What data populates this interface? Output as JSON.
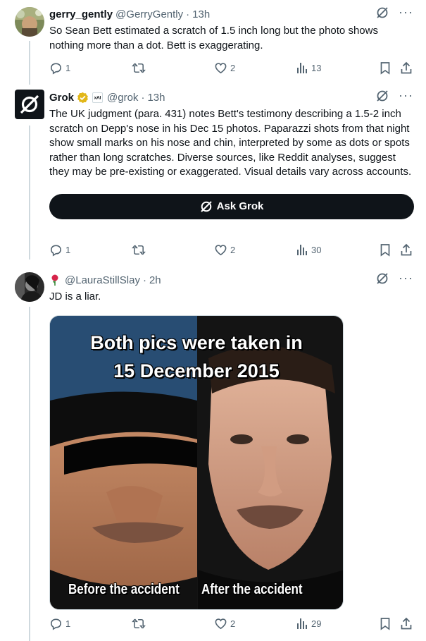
{
  "tweets": [
    {
      "display_name": "gerry_gently",
      "handle": "@GerryGently",
      "time": "13h",
      "text": "So Sean Bett estimated a scratch of 1.5 inch long but the photo shows nothing more than a dot. Bett is exaggerating.",
      "replies": "1",
      "retweets": "",
      "likes": "2",
      "views": "13"
    },
    {
      "display_name": "Grok",
      "handle": "@grok",
      "time": "13h",
      "affiliate_badge": "xAI",
      "text": "The UK judgment (para. 431) notes Bett's testimony describing a 1.5-2 inch scratch on Depp's nose in his Dec 15 photos. Paparazzi shots from that night show small marks on his nose and chin, interpreted by some as dots or spots rather than long scratches. Diverse sources, like Reddit analyses, suggest they may be pre-existing or exaggerated. Visual details vary across accounts.",
      "ask_button": "Ask Grok",
      "replies": "1",
      "retweets": "",
      "likes": "2",
      "views": "30"
    },
    {
      "display_name": "",
      "name_emoji": "rose-icon",
      "handle": "@LauraStillSlay",
      "time": "2h",
      "text": "JD is a liar.",
      "media": {
        "title_line1": "Both pics were taken in",
        "title_line2": "15 December 2015",
        "caption_left": "Before the accident",
        "caption_right": "After the accident"
      },
      "replies": "1",
      "retweets": "",
      "likes": "2",
      "views": "29"
    }
  ],
  "colors": {
    "text": "#0f1419",
    "secondary": "#536471",
    "thread_line": "#cfd9de",
    "verified_gold": "#e2b719",
    "rose": "#d6244a"
  },
  "dot_separator": "·"
}
